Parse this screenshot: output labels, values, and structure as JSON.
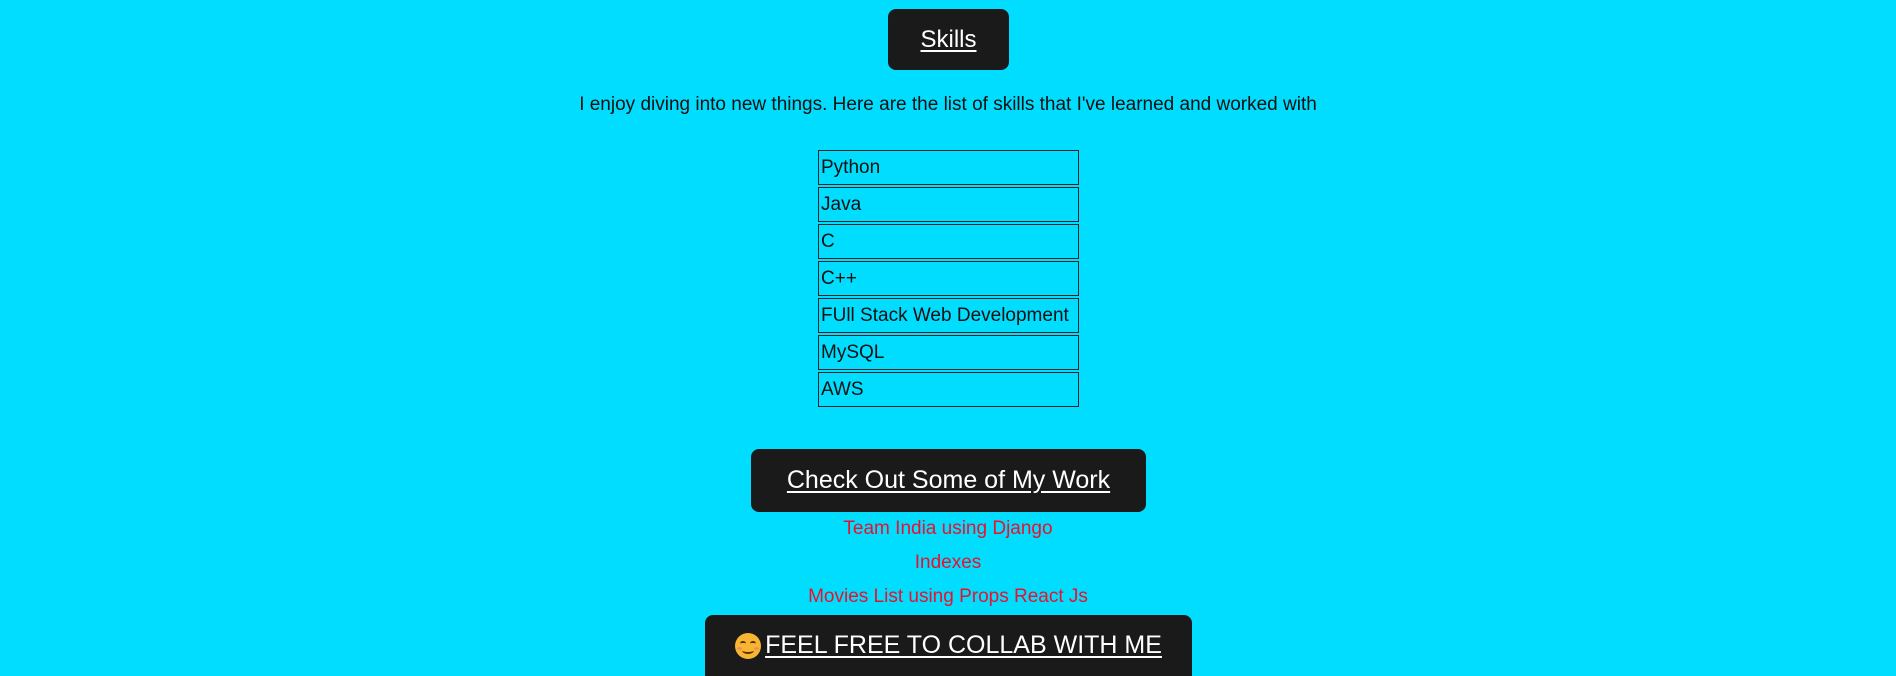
{
  "skills": {
    "heading": "Skills",
    "intro": "I enjoy diving into new things. Here are the list of skills that I've learned and worked with",
    "items": [
      "Python",
      "Java",
      "C",
      "C++",
      "FUll Stack Web Development",
      "MySQL",
      "AWS"
    ]
  },
  "work": {
    "heading": "Check Out Some of My Work",
    "projects": [
      "Team India using Django",
      "Indexes",
      "Movies List using Props React Js"
    ]
  },
  "collab": {
    "emoji": "smiling-face-icon",
    "heading": "FEEL FREE TO COLLAB WITH ME"
  },
  "colors": {
    "background": "#00ddff",
    "heading_bg": "#1a1a1a",
    "heading_text": "#ffffff",
    "link": "#e8122d"
  }
}
